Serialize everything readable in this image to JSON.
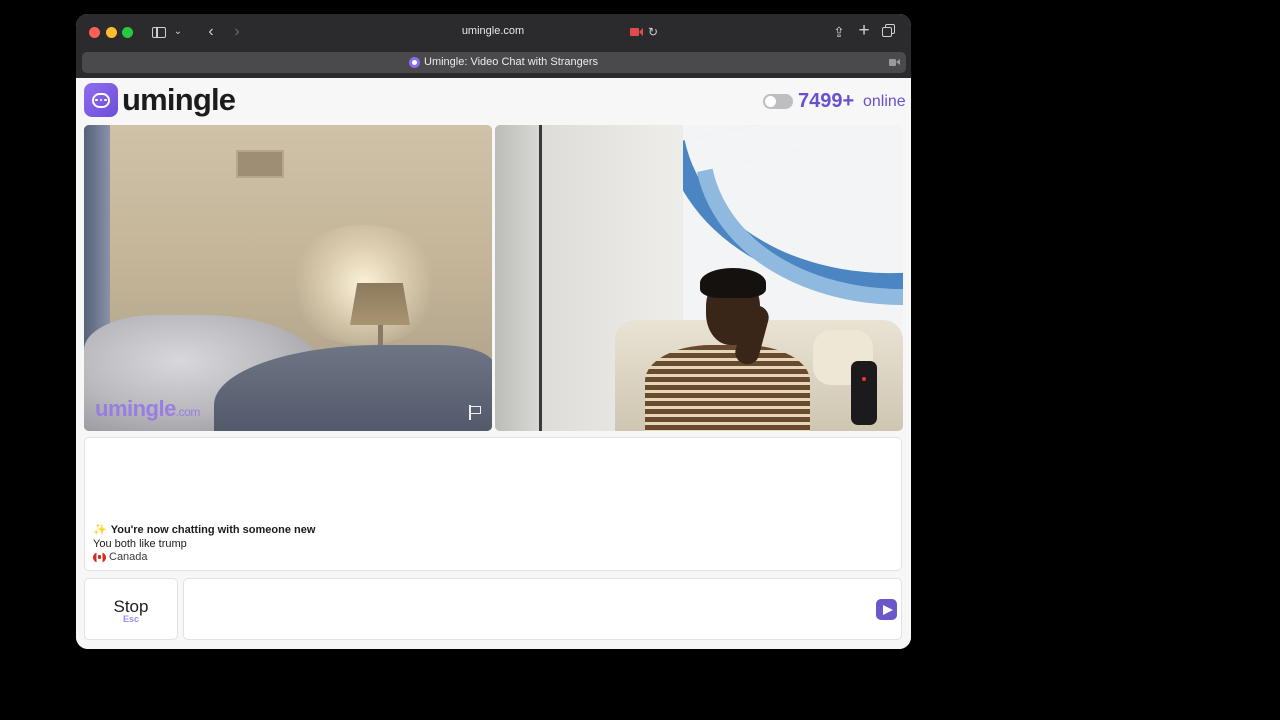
{
  "browser": {
    "address": "umingle.com",
    "tab_title": "Umingle: Video Chat with Strangers"
  },
  "header": {
    "logo_text": "umingle",
    "online_count": "7499+",
    "online_label": "online",
    "toggle_on": false
  },
  "video": {
    "watermark_main": "umingle",
    "watermark_suffix": ".com"
  },
  "chat": {
    "system_icon": "✨",
    "system_message": "You're now chatting with someone new",
    "common_interest": "You both like trump",
    "country": "Canada"
  },
  "controls": {
    "stop_label": "Stop",
    "stop_hint": "Esc",
    "message_value": ""
  },
  "colors": {
    "brand": "#6a4fd0",
    "send_button": "#6b57c8"
  }
}
